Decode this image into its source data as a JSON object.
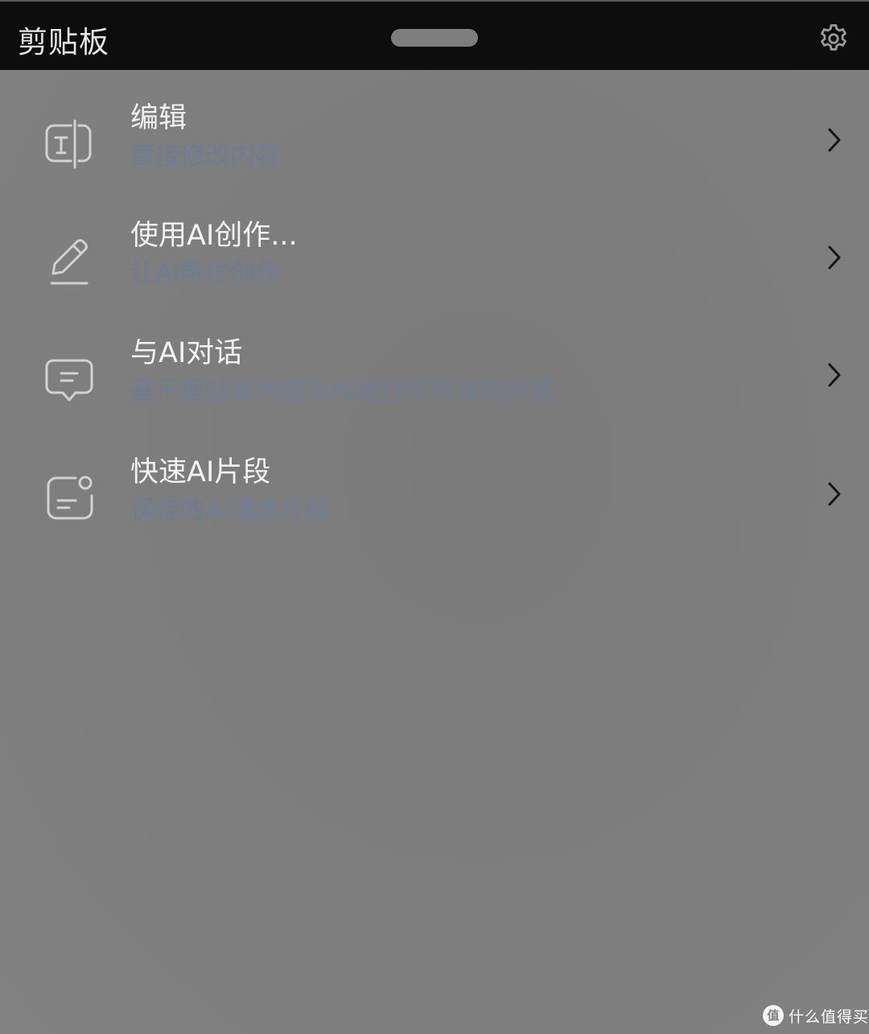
{
  "header": {
    "title": "剪贴板",
    "settings_icon": "gear-icon"
  },
  "menu": {
    "items": [
      {
        "title": "编辑",
        "subtitle": "直接修改内容",
        "icon": "text-edit-icon"
      },
      {
        "title": "使用AI创作...",
        "subtitle": "让AI帮忙创作",
        "icon": "pencil-icon"
      },
      {
        "title": "与AI对话",
        "subtitle": "基于剪贴板内容与AI进行可持续的对话",
        "icon": "chat-bubble-icon"
      },
      {
        "title": "快速AI片段",
        "subtitle": "保存的AI请求片段",
        "icon": "snippet-icon"
      }
    ]
  },
  "watermark": {
    "badge": "值",
    "text": "什么值得买"
  },
  "colors": {
    "header_bg": "#0d0d0d",
    "page_bg": "#7d7d7d",
    "title_text": "#f2f2f2",
    "subtitle_text": "#6f7c92"
  }
}
